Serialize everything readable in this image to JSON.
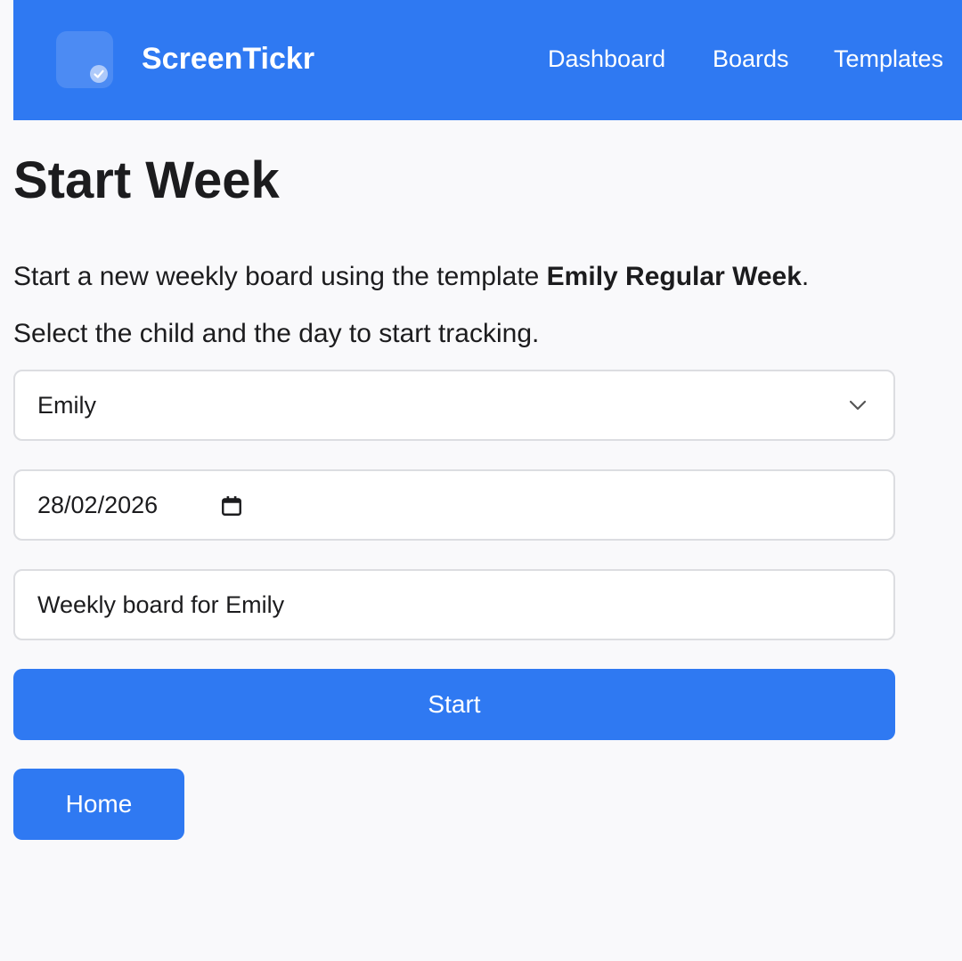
{
  "header": {
    "brand": "ScreenTickr",
    "nav": {
      "dashboard": "Dashboard",
      "boards": "Boards",
      "templates": "Templates"
    },
    "accent_color": "#2f79f2"
  },
  "main": {
    "title": "Start Week",
    "intro_prefix": "Start a new weekly board using the template ",
    "template_name": "Emily Regular Week",
    "intro_suffix": ".",
    "instruction": "Select the child and the day to start tracking.",
    "child_select": {
      "value": "Emily",
      "icon": "chevron-down-icon"
    },
    "date_input": {
      "value": "28/02/2026",
      "icon": "calendar-icon"
    },
    "board_name_input": {
      "value": "Weekly board for Emily"
    },
    "start_button": "Start",
    "home_button": "Home"
  }
}
